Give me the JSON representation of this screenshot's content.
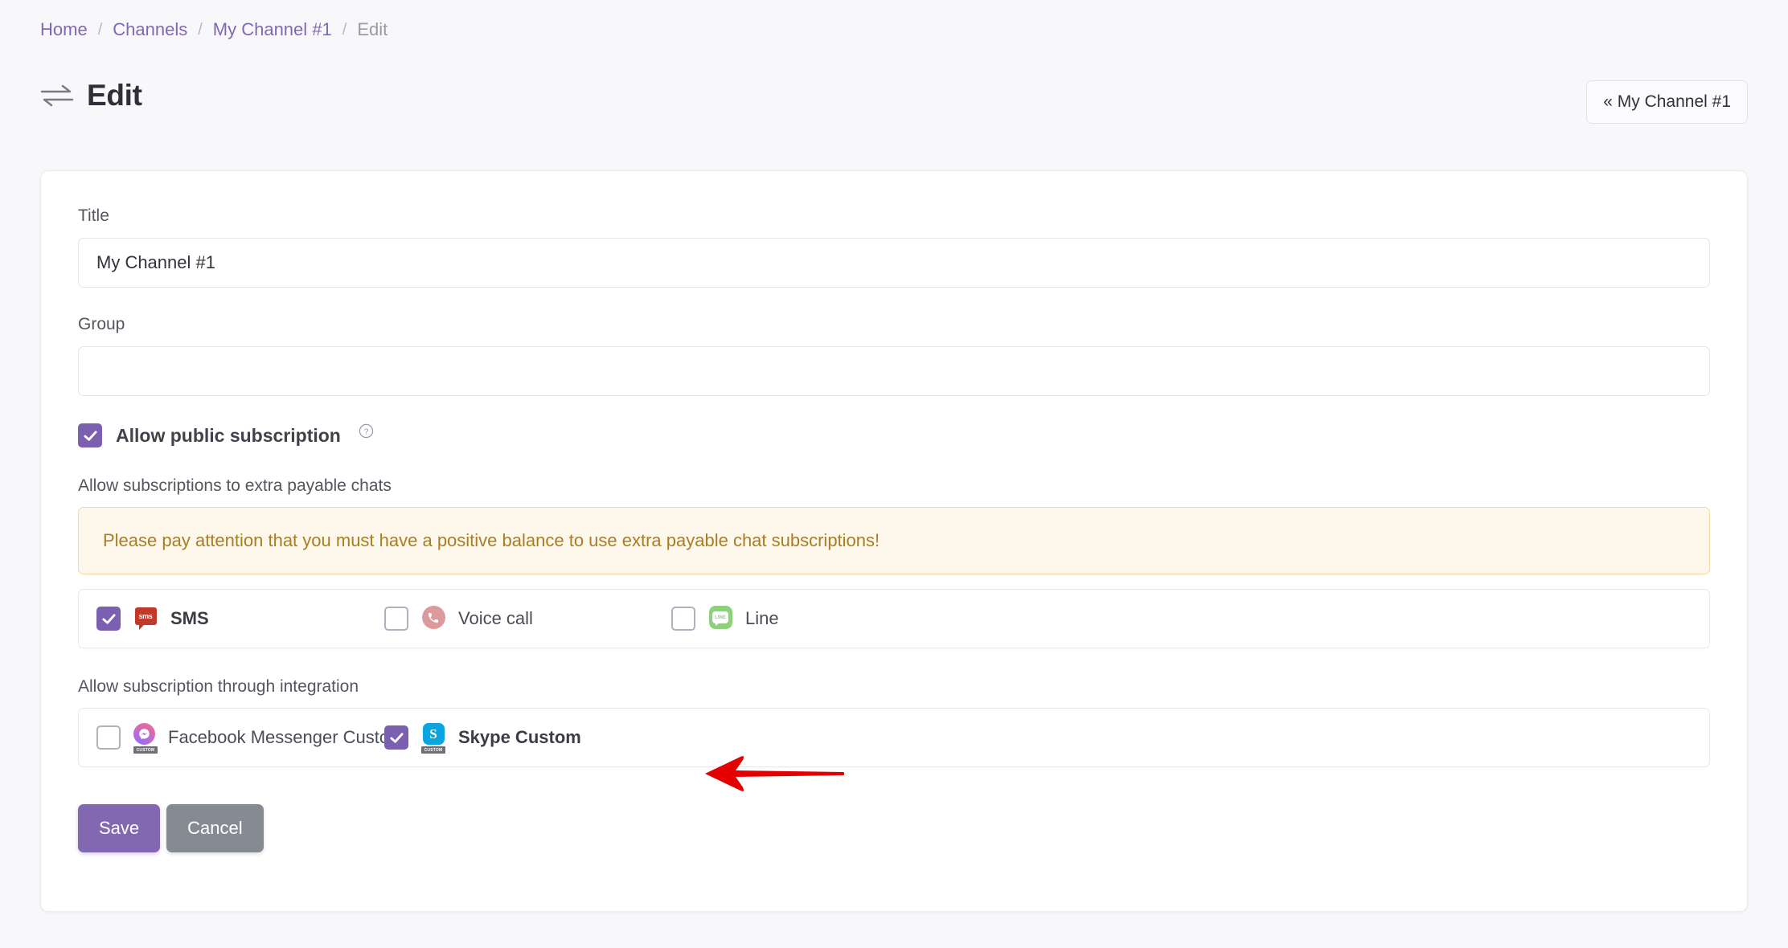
{
  "breadcrumb": {
    "items": [
      {
        "label": "Home",
        "current": false
      },
      {
        "label": "Channels",
        "current": false
      },
      {
        "label": "My Channel #1",
        "current": false
      },
      {
        "label": "Edit",
        "current": true
      }
    ],
    "separator": "/"
  },
  "header": {
    "title": "Edit",
    "icon": "swap-arrows-icon",
    "back_button": "« My Channel #1"
  },
  "form": {
    "title_field": {
      "label": "Title",
      "value": "My Channel #1",
      "placeholder": ""
    },
    "group_field": {
      "label": "Group",
      "value": "",
      "placeholder": ""
    },
    "public_subscription": {
      "label": "Allow public subscription",
      "checked": true,
      "help_icon": "question-mark-icon"
    },
    "payable_chats": {
      "label": "Allow subscriptions to extra payable chats",
      "warning": "Please pay attention that you must have a positive balance to use extra payable chat subscriptions!",
      "options": [
        {
          "label": "SMS",
          "checked": true,
          "icon": "sms-icon",
          "icon_text": "sms"
        },
        {
          "label": "Voice call",
          "checked": false,
          "icon": "phone-icon"
        },
        {
          "label": "Line",
          "checked": false,
          "icon": "line-icon",
          "icon_text": "LINE"
        }
      ]
    },
    "integration": {
      "label": "Allow subscription through integration",
      "options": [
        {
          "label": "Facebook Messenger Custom",
          "checked": false,
          "icon": "messenger-icon",
          "badge": "CUSTOM"
        },
        {
          "label": "Skype Custom",
          "checked": true,
          "icon": "skype-icon",
          "badge": "CUSTOM"
        }
      ]
    },
    "actions": {
      "save_label": "Save",
      "cancel_label": "Cancel"
    }
  },
  "annotation": {
    "arrow": "red-left-arrow",
    "color": "#e40000"
  },
  "colors": {
    "accent": "#7b5fb0",
    "save": "#8268b0",
    "cancel": "#868b93",
    "warning_bg": "#fdf7ec",
    "warning_border": "#f3d9a6",
    "warning_text": "#a97e22",
    "page_bg": "#f8f7fa",
    "link": "#8068b5"
  }
}
